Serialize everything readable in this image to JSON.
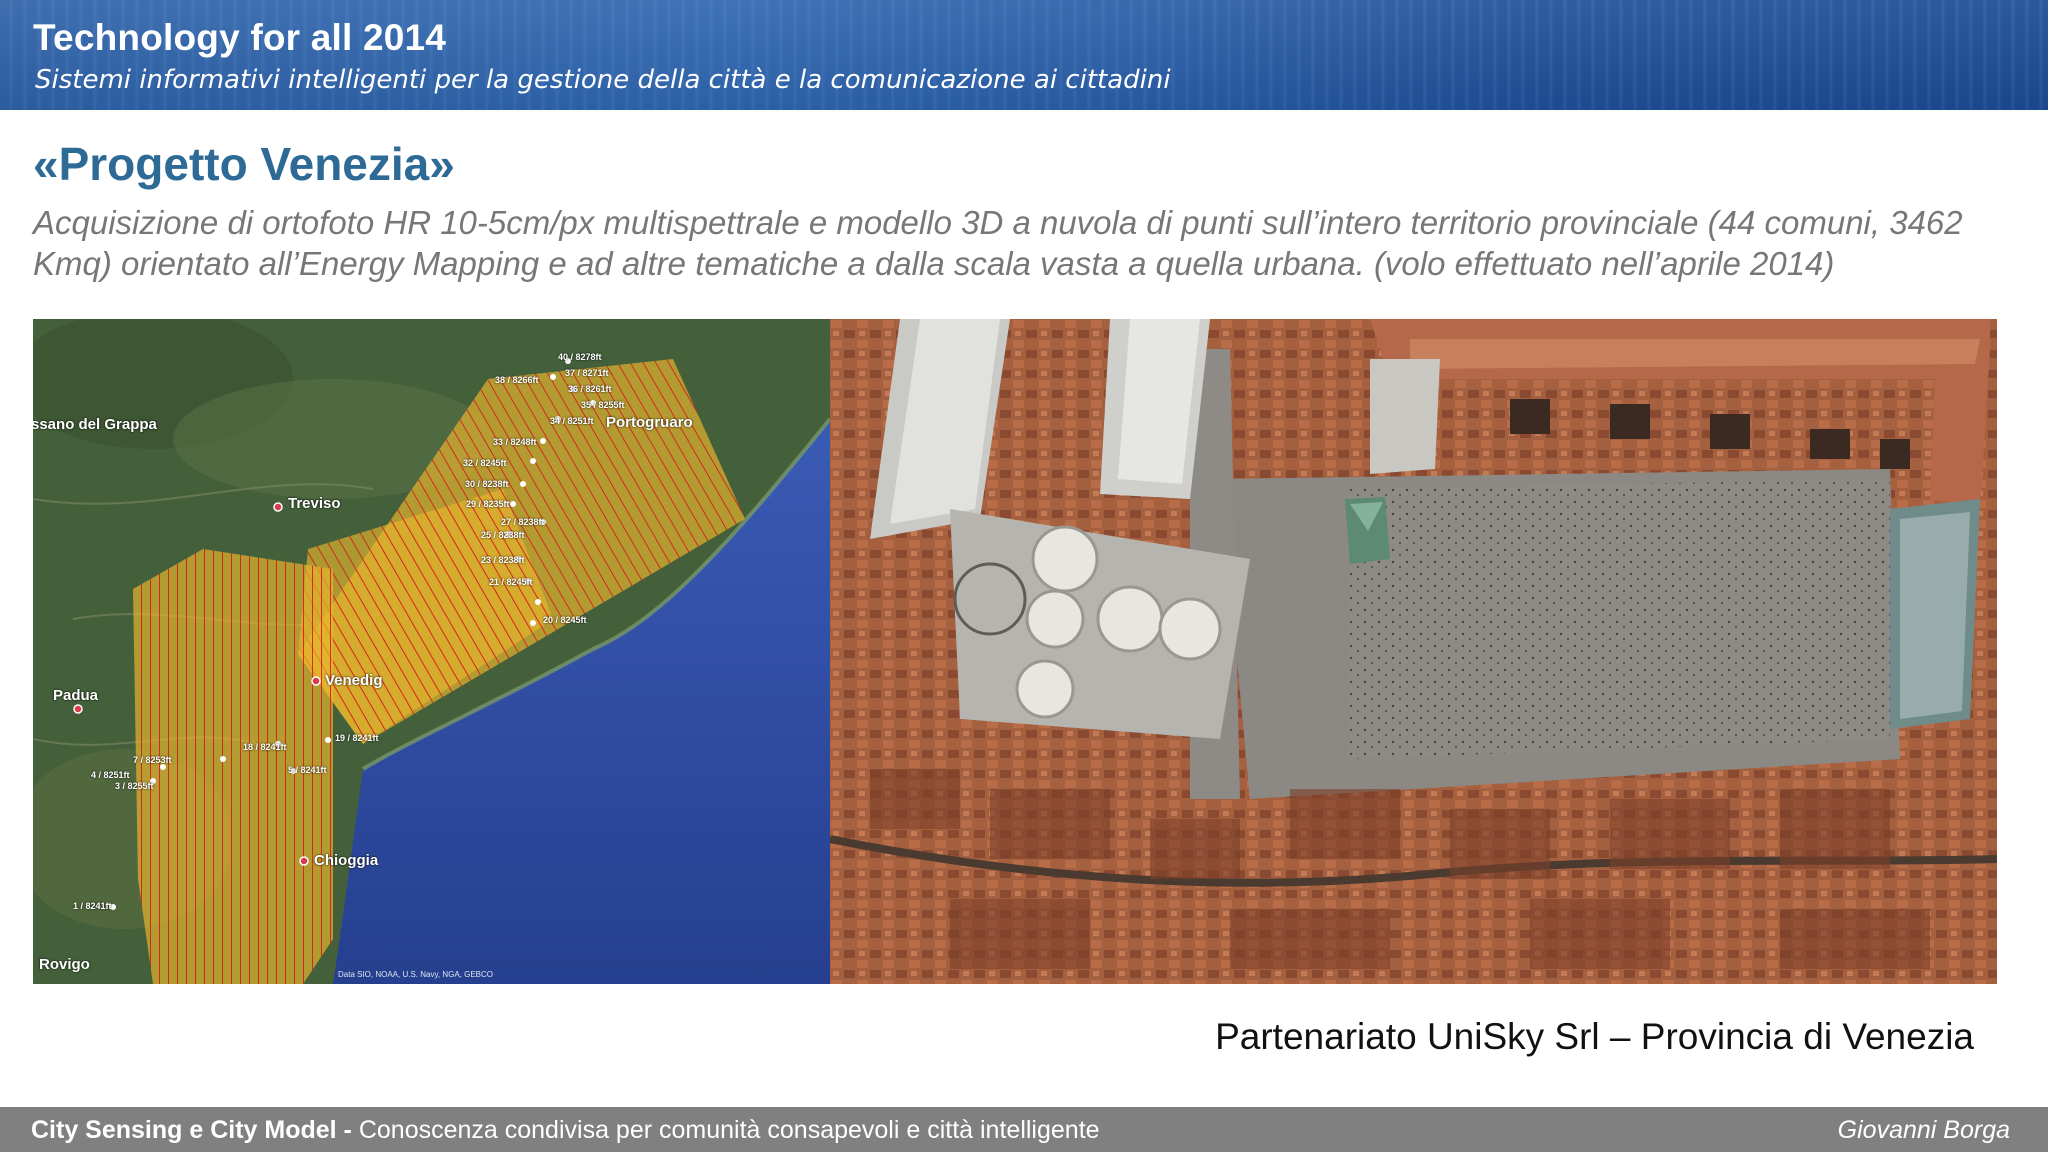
{
  "header": {
    "title": "Technology for all 2014",
    "subtitle": "Sistemi informativi intelligenti per la gestione della città e la comunicazione ai cittadini"
  },
  "slide": {
    "title": "«Progetto Venezia»",
    "description": "Acquisizione di ortofoto HR 10-5cm/px multispettrale e modello 3D a nuvola di punti sull’intero territorio provinciale (44 comuni, 3462 Kmq) orientato all’Energy Mapping e ad altre tematiche a dalla scala vasta a quella urbana. (volo effettuato nell’aprile 2014)",
    "partnership": "Partenariato UniSky Srl – Provincia di Venezia"
  },
  "map": {
    "places": [
      "ssano del Grappa",
      "Treviso",
      "Portogruaro",
      "Venedig",
      "Padua",
      "Chioggia",
      "Rovigo"
    ],
    "waypoints": [
      "40 / 8278ft",
      "38 / 8266ft",
      "37 / 8271ft",
      "36 / 8261ft",
      "35 / 8255ft",
      "34 / 8251ft",
      "33 / 8248ft",
      "32 / 8245ft",
      "30 / 8238ft",
      "29 / 8235ft",
      "27 / 8238ft",
      "25 / 8238ft",
      "23 / 8238ft",
      "21 / 8245ft",
      "20 / 8245ft",
      "19 / 8241ft",
      "18 / 8241ft",
      "7 / 8253ft",
      "4 / 8251ft",
      "3 / 8255ft",
      "5 / 8241ft",
      "1 / 8241ft"
    ],
    "credit": "Data SIO, NOAA, U.S. Navy, NGA, GEBCO",
    "colors": {
      "flight_area": "#e8b52c",
      "flight_lines": "#d8281c",
      "sea": "#2f4fa8",
      "land": "#4a6339"
    }
  },
  "footer": {
    "left_bold": "City Sensing e City Model - ",
    "left_text": "Conoscenza condivisa per comunità consapevoli e città intelligente",
    "right": "Giovanni Borga"
  }
}
